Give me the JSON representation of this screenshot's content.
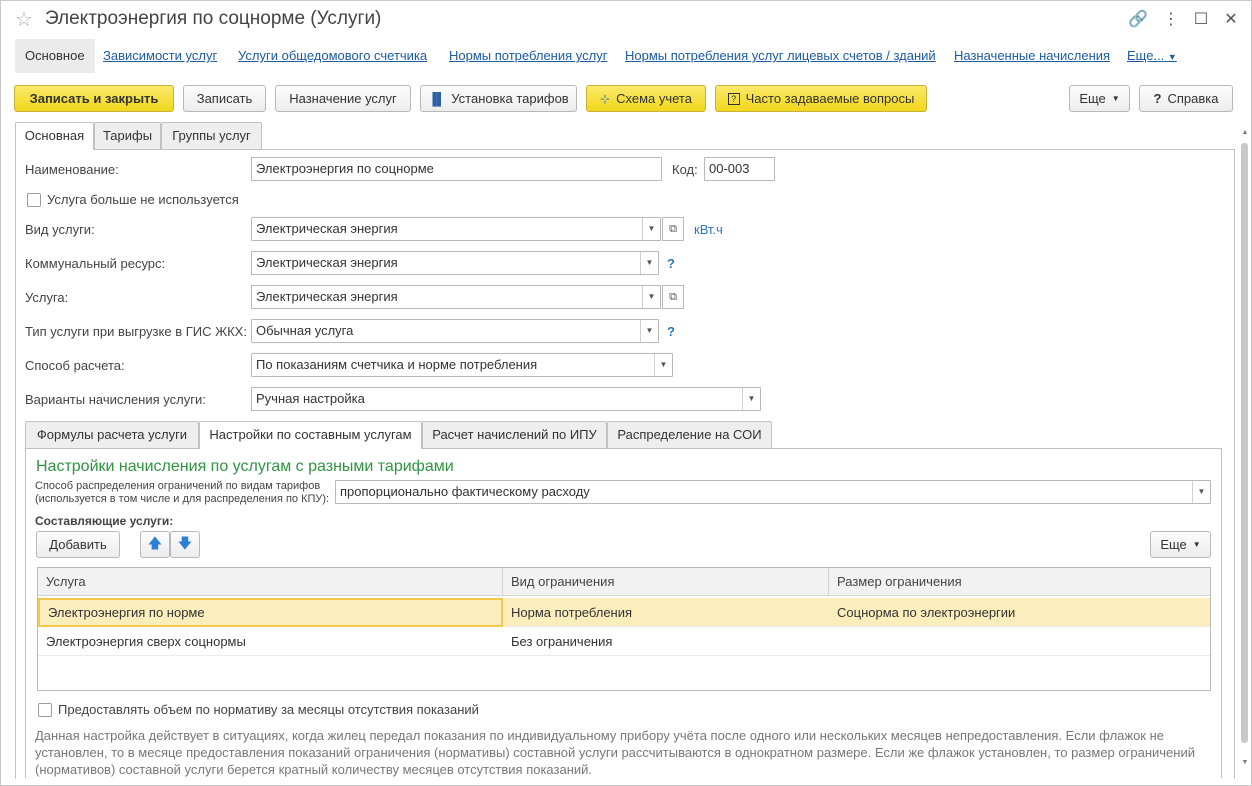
{
  "window": {
    "title": "Электроэнергия по соцнорме (Услуги)"
  },
  "nav": {
    "items": [
      "Основное",
      "Зависимости услуг",
      "Услуги общедомового счетчика",
      "Нормы потребления услуг",
      "Нормы потребления услуг лицевых счетов / зданий",
      "Назначенные начисления",
      "Еще..."
    ]
  },
  "toolbar": {
    "save_close": "Записать и закрыть",
    "save": "Записать",
    "assign": "Назначение услуг",
    "tariffs": "Установка тарифов",
    "scheme": "Схема учета",
    "faq": "Часто задаваемые вопросы",
    "more": "Еще",
    "help": "Справка"
  },
  "tabs": [
    "Основная",
    "Тарифы",
    "Группы услуг"
  ],
  "form": {
    "name_label": "Наименование:",
    "name_value": "Электроэнергия по соцнорме",
    "code_label": "Код:",
    "code_value": "00-003",
    "unused_label": "Услуга больше не используется",
    "kind_label": "Вид услуги:",
    "kind_value": "Электрическая энергия",
    "unit": "кВт.ч",
    "resource_label": "Коммунальный ресурс:",
    "resource_value": "Электрическая энергия",
    "service_label": "Услуга:",
    "service_value": "Электрическая энергия",
    "gis_label": "Тип услуги при выгрузке в ГИС ЖКХ:",
    "gis_value": "Обычная услуга",
    "method_label": "Способ расчета:",
    "method_value": "По показаниям счетчика и норме потребления",
    "variants_label": "Варианты начисления услуги:",
    "variants_value": "Ручная настройка",
    "help_mark": "?"
  },
  "subtabs": [
    "Формулы расчета услуги",
    "Настройки по составным услугам",
    "Расчет начислений по ИПУ",
    "Распределение на СОИ"
  ],
  "composite": {
    "title": "Настройки начисления по услугам с разными тарифами",
    "dist_label_1": "Способ распределения ограничений по видам тарифов",
    "dist_label_2": "(используется в том числе и для распределения по КПУ):",
    "dist_value": "пропорционально фактическому расходу",
    "components_label": "Составляющие услуги:",
    "add": "Добавить",
    "more": "Еще",
    "columns": [
      "Услуга",
      "Вид ограничения",
      "Размер ограничения"
    ],
    "rows": [
      [
        "Электроэнергия по норме",
        "Норма потребления",
        "Соцнорма по электроэнергии"
      ],
      [
        "Электроэнергия сверх соцнормы",
        "Без ограничения",
        ""
      ]
    ],
    "provide_label": "Предоставлять объем по нормативу за месяцы отсутствия показаний",
    "note": "Данная настройка действует в ситуациях, когда жилец передал показания по индивидуальному прибору учёта после одного или нескольких месяцев непредоставления. Если флажок не установлен, то в месяце предоставления показаний ограничения (нормативы) составной услуги рассчитываются в однократном размере. Если же флажок установлен, то размер ограничений (нормативов) составной услуги берется кратный количеству месяцев отсутствия показаний."
  }
}
